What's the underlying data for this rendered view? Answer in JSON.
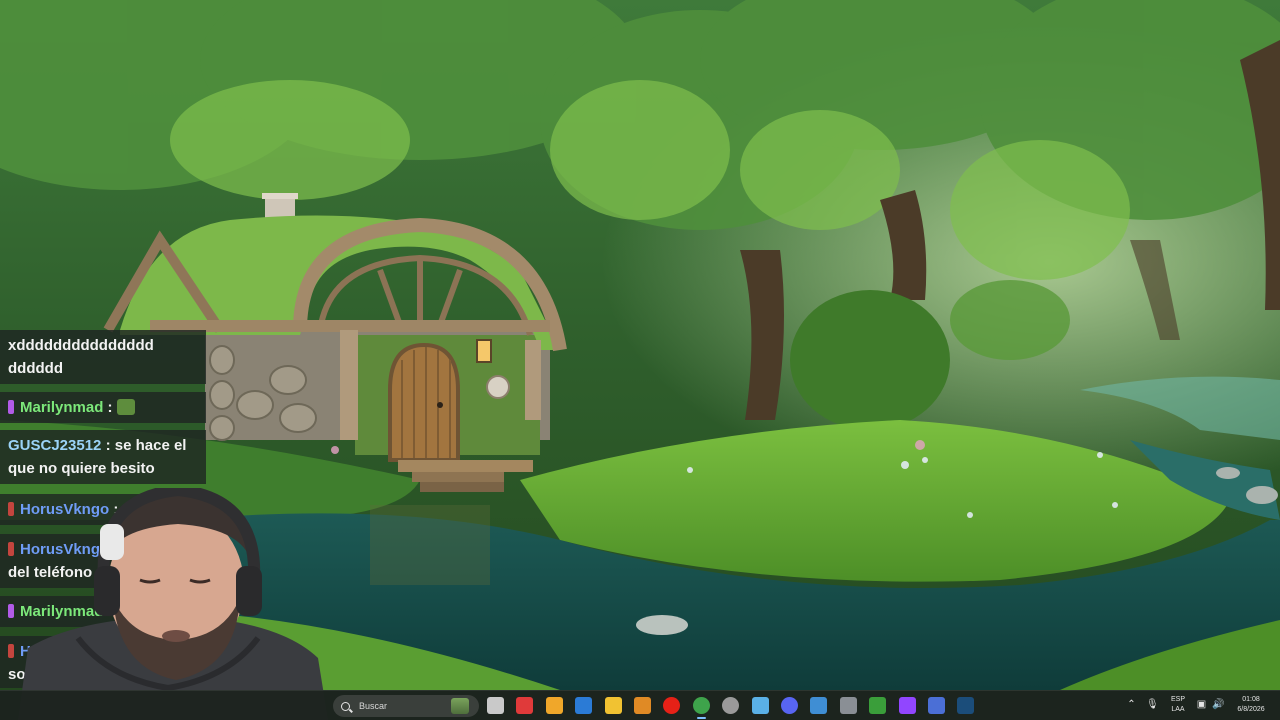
{
  "chat": {
    "messages": [
      {
        "text": "xddddddddddddddd dddddd"
      },
      {
        "user": "Marilynmad",
        "sep": ":"
      },
      {
        "user": "GUSCJ23512",
        "sep": ":",
        "text": "se hace el que no quiere besito"
      },
      {
        "user": "HorusVkngo",
        "sep": ":"
      },
      {
        "user": "HorusVkng",
        "text": "del teléfono"
      },
      {
        "user": "Marilynmad"
      },
      {
        "user": "Hor",
        "text": "so"
      }
    ]
  },
  "taskbar": {
    "search_placeholder": "Buscar",
    "apps": [
      {
        "name": "task-view-icon",
        "color": "#c9c9c9"
      },
      {
        "name": "app-red-icon",
        "color": "#e03a3a"
      },
      {
        "name": "microsoft-store-icon",
        "color": "#f0a72a"
      },
      {
        "name": "outlook-icon",
        "color": "#2b7bd6"
      },
      {
        "name": "file-explorer-icon",
        "color": "#f1c232"
      },
      {
        "name": "app-orange-icon",
        "color": "#e08a25"
      },
      {
        "name": "youtube-icon",
        "color": "#e62117"
      },
      {
        "name": "chrome-icon",
        "color": "#3ea34b"
      },
      {
        "name": "app-circle-icon",
        "color": "#9a9a9a"
      },
      {
        "name": "notepad-icon",
        "color": "#5ab0e6"
      },
      {
        "name": "discord-icon",
        "color": "#5865f2"
      },
      {
        "name": "photos-icon",
        "color": "#3f8ed4"
      },
      {
        "name": "controller-icon",
        "color": "#8a8f95"
      },
      {
        "name": "app-green-icon",
        "color": "#3a9e3a"
      },
      {
        "name": "twitch-icon",
        "color": "#9146ff"
      },
      {
        "name": "app-blue-icon",
        "color": "#4b6fd6"
      },
      {
        "name": "steam-icon",
        "color": "#1b4d7a"
      }
    ],
    "language": {
      "line1": "ESP",
      "line2": "LAA"
    },
    "clock": {
      "time": "01:08",
      "date": "6/8/2026"
    }
  }
}
